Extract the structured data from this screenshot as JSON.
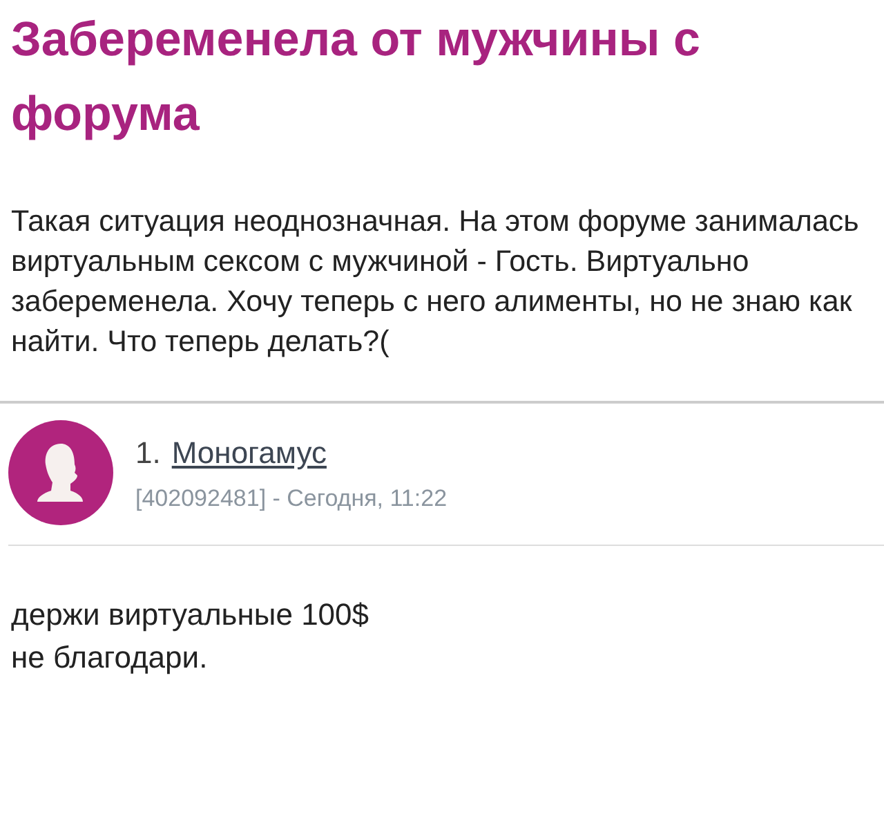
{
  "topic": {
    "title": "Забеременела от мужчины с форума",
    "text": "Такая ситуация неоднозначная. На этом форуме занималась виртуальным сексом с мужчиной - Гость. Виртуально забеременела. Хочу теперь с него алименты, но не знаю как найти. Что теперь делать?("
  },
  "replies": [
    {
      "number": "1.",
      "author": "Моногамус",
      "meta": "[402092481] - Сегодня, 11:22",
      "text": "держи виртуальные 100$\nне благодари."
    }
  ]
}
